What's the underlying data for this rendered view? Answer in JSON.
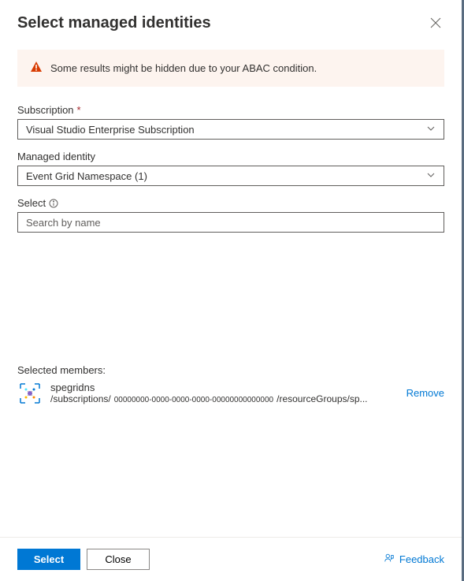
{
  "header": {
    "title": "Select managed identities"
  },
  "banner": {
    "message": "Some results might be hidden due to your ABAC condition."
  },
  "fields": {
    "subscription": {
      "label": "Subscription",
      "required_marker": "*",
      "value": "Visual Studio Enterprise Subscription"
    },
    "managed_identity": {
      "label": "Managed identity",
      "value": "Event Grid Namespace (1)"
    },
    "select": {
      "label": "Select",
      "placeholder": "Search by name"
    }
  },
  "selected_members": {
    "heading": "Selected members:",
    "items": [
      {
        "name": "spegridns",
        "path_prefix": "/subscriptions/",
        "path_guid": "00000000-0000-0000-0000-00000000000000",
        "path_suffix": "/resourceGroups/sp...",
        "remove_label": "Remove"
      }
    ]
  },
  "footer": {
    "select_label": "Select",
    "close_label": "Close",
    "feedback_label": "Feedback"
  }
}
